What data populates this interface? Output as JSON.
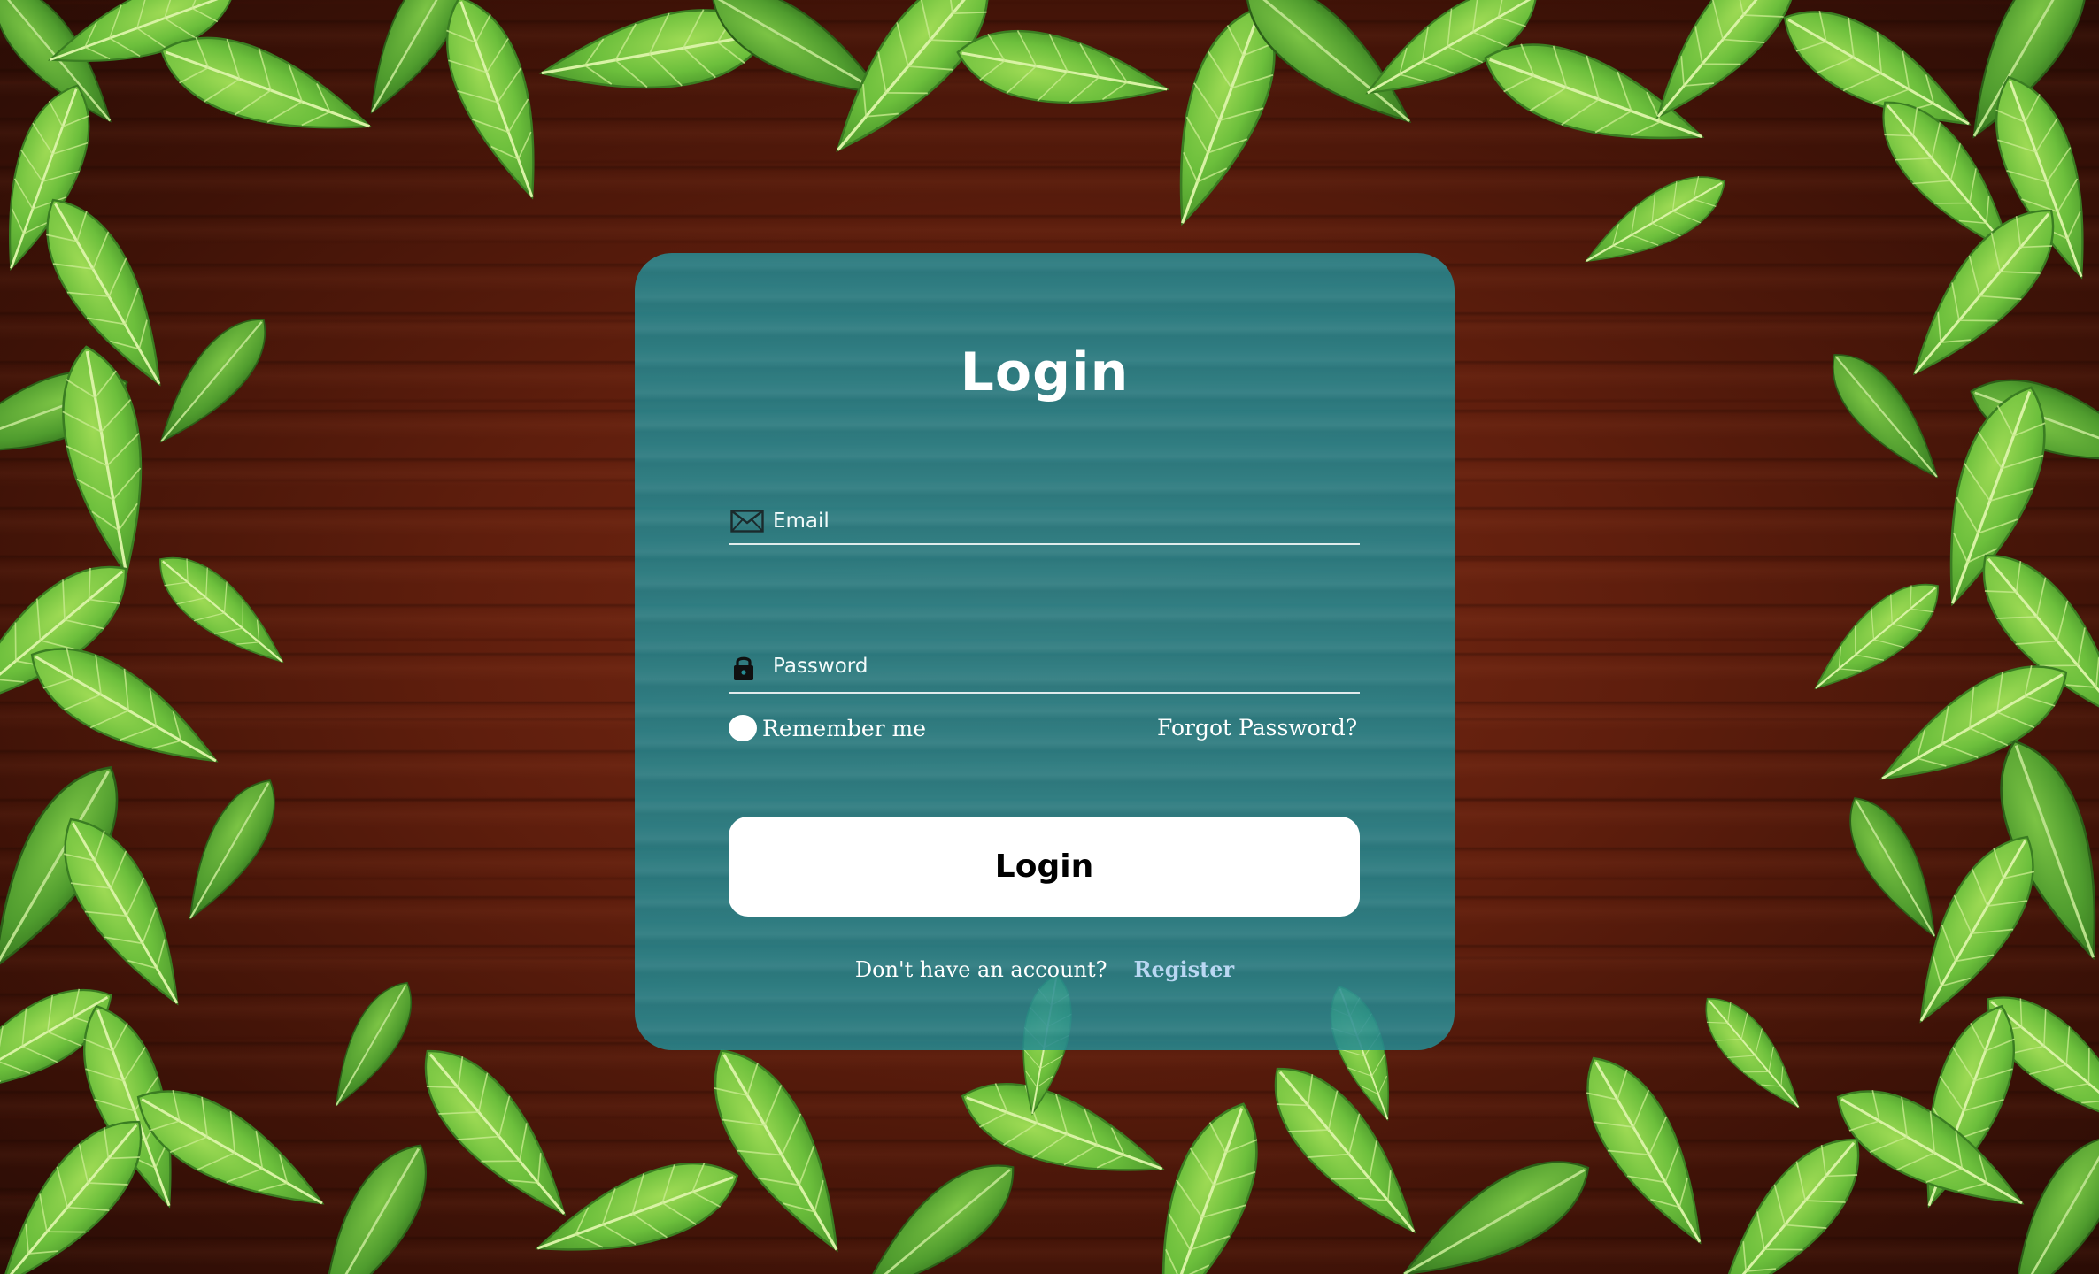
{
  "background": {
    "description_icon": "wood-and-leaves-background",
    "colors": {
      "wood": "#5f1e0d",
      "leaf": "#5cae3a",
      "leaf_light": "#8fd24e",
      "vein": "#d6f0a0"
    }
  },
  "card": {
    "color": "#268c94",
    "title": "Login",
    "email": {
      "placeholder": "Email",
      "icon": "envelope-icon"
    },
    "password": {
      "placeholder": "Password",
      "icon": "lock-icon"
    },
    "remember_label": "Remember me",
    "forgot_label": "Forgot Password?",
    "login_button": "Login",
    "footer": {
      "question": "Don't have an account?",
      "register_link": "Register",
      "link_color": "#b9d7f2"
    }
  }
}
